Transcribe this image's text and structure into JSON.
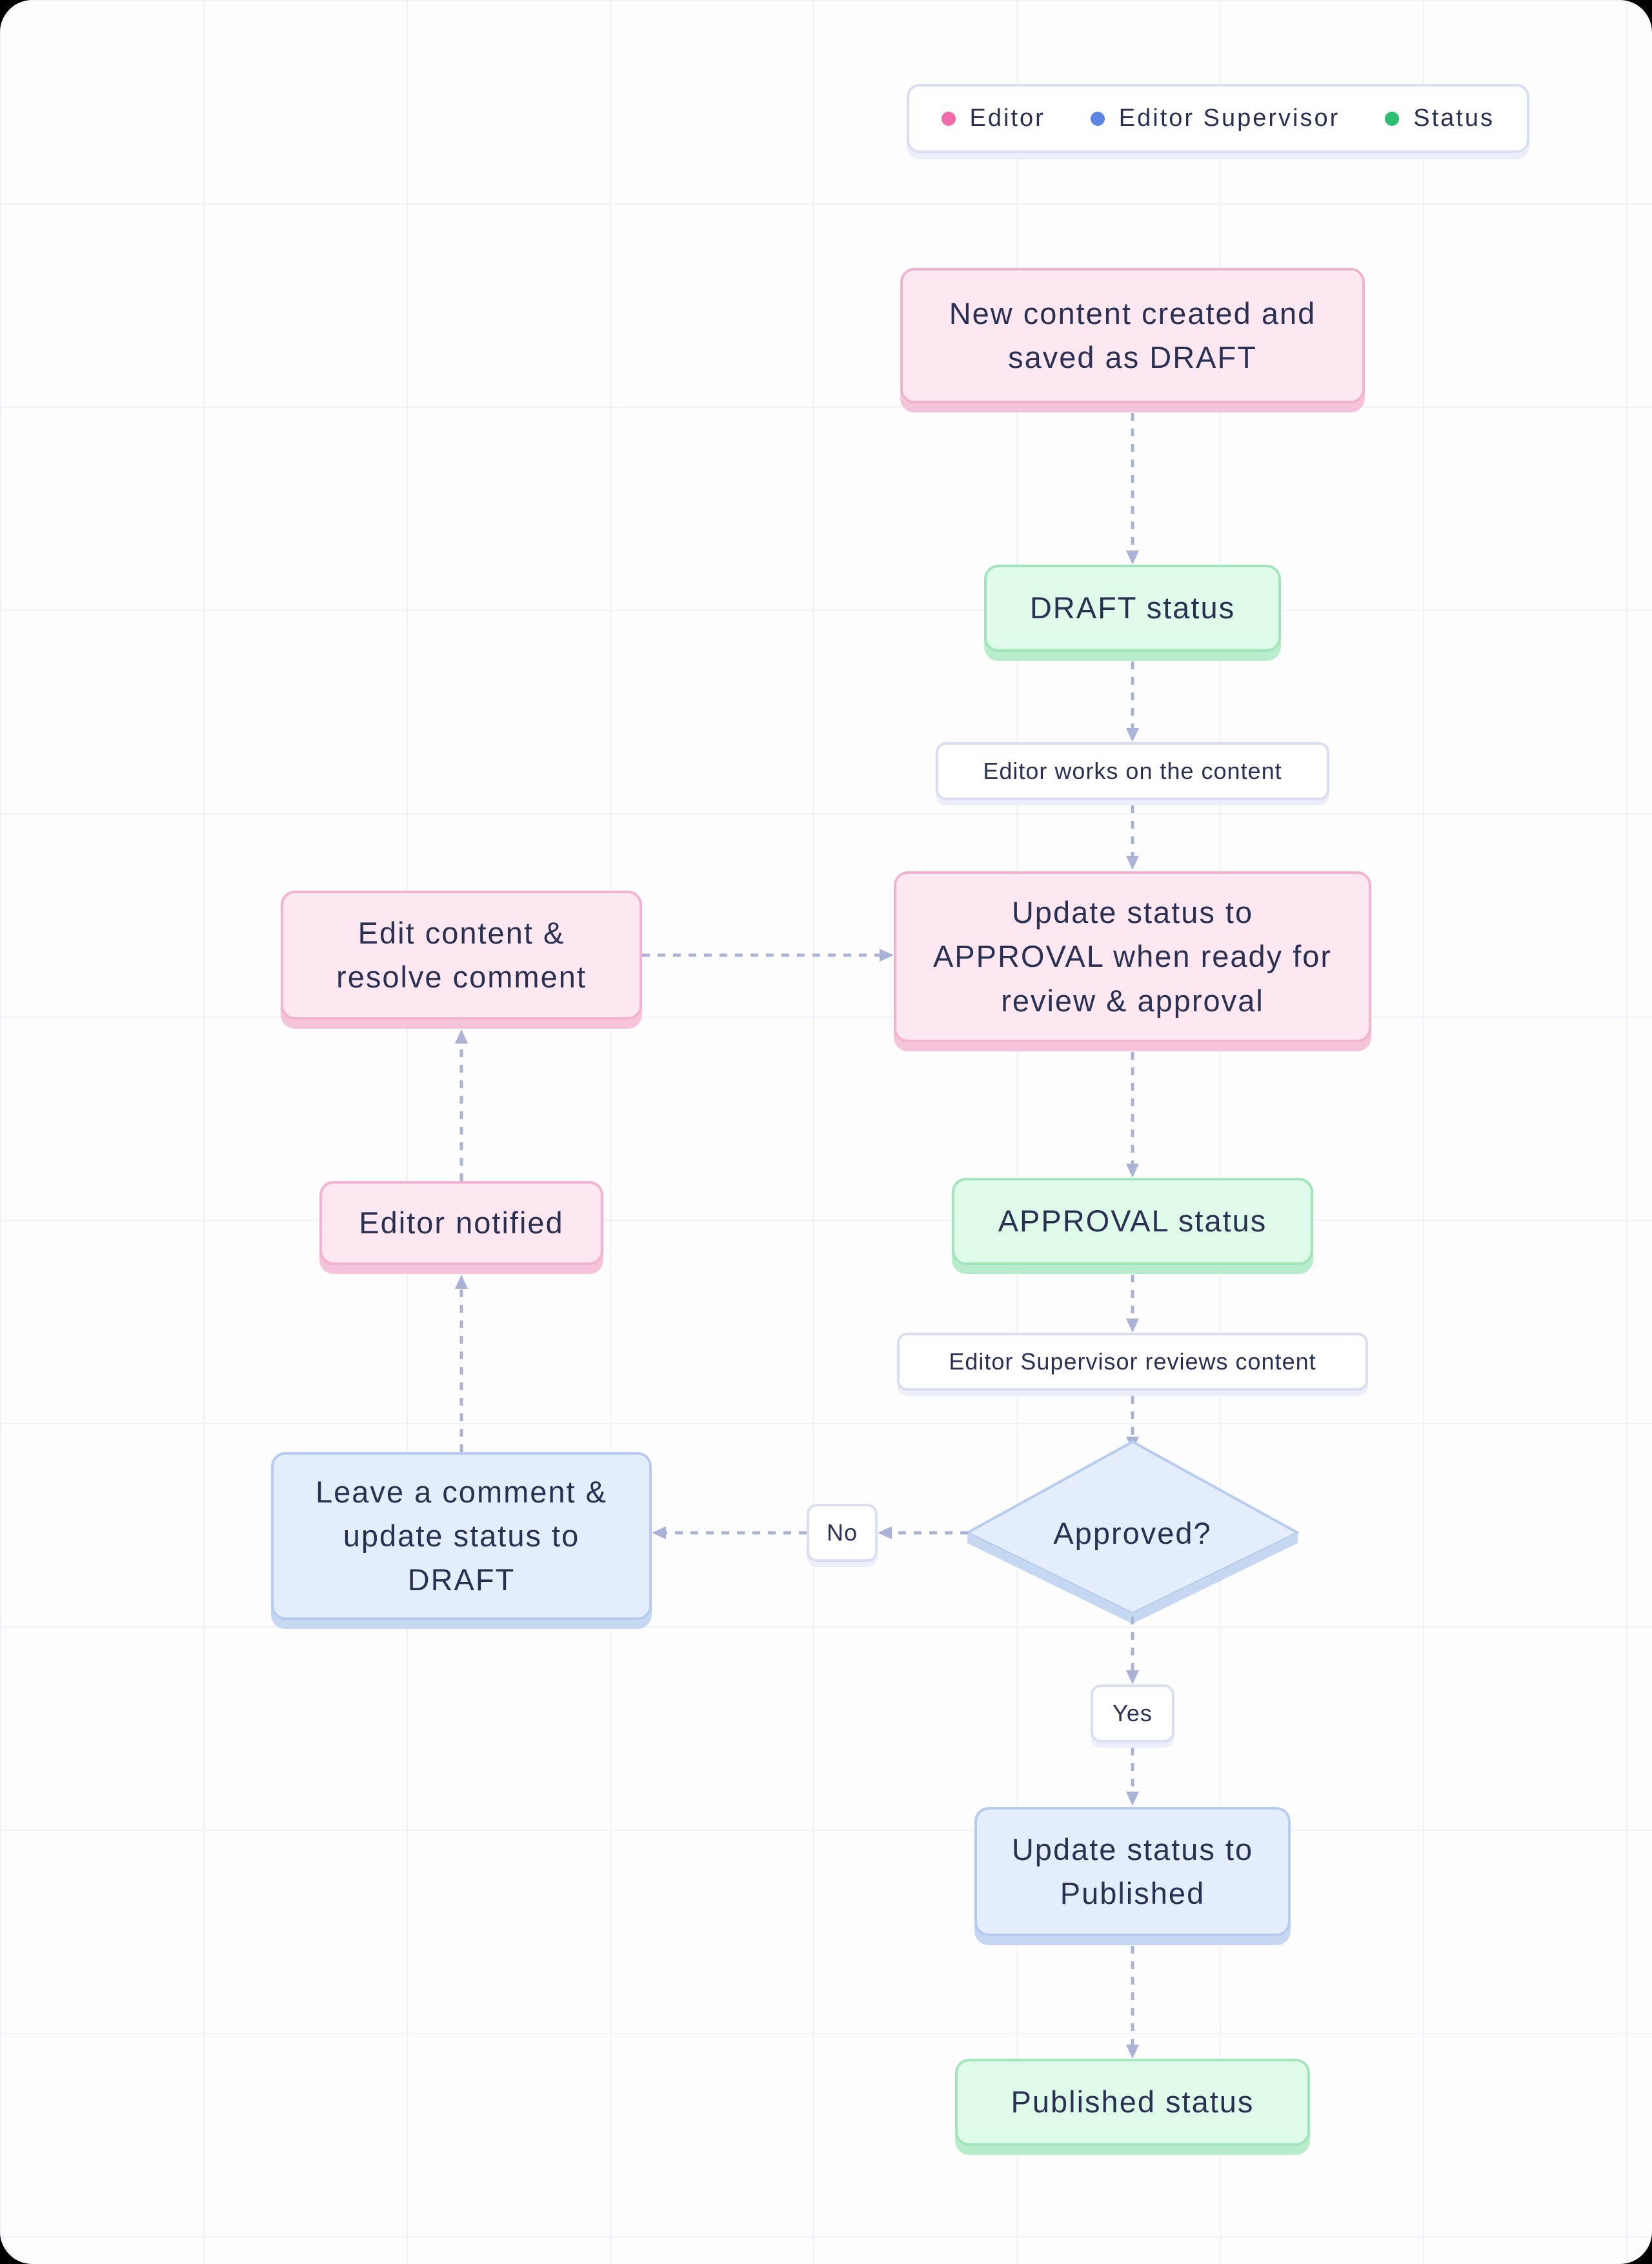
{
  "legend": {
    "items": [
      {
        "label": "Editor",
        "color": "#f06ba8"
      },
      {
        "label": "Editor Supervisor",
        "color": "#5c85e6"
      },
      {
        "label": "Status",
        "color": "#2dbf71"
      }
    ]
  },
  "nodes": {
    "new_content": "New content created and saved as DRAFT",
    "draft_status": "DRAFT status",
    "editor_works": "Editor works on the content",
    "update_approval": "Update status to APPROVAL when ready for review & approval",
    "edit_resolve": "Edit content & resolve comment",
    "approval_status": "APPROVAL status",
    "supervisor_reviews": "Editor Supervisor reviews content",
    "approved_q": "Approved?",
    "no": "No",
    "yes": "Yes",
    "leave_comment": "Leave a comment & update status to DRAFT",
    "editor_notified": "Editor notified",
    "update_published": "Update status to Published",
    "published_status": "Published status"
  },
  "colors": {
    "editor": "#fde8f2",
    "supervisor": "#e4edfb",
    "status": "#ddfbe8",
    "neutral": "#ffffff"
  }
}
